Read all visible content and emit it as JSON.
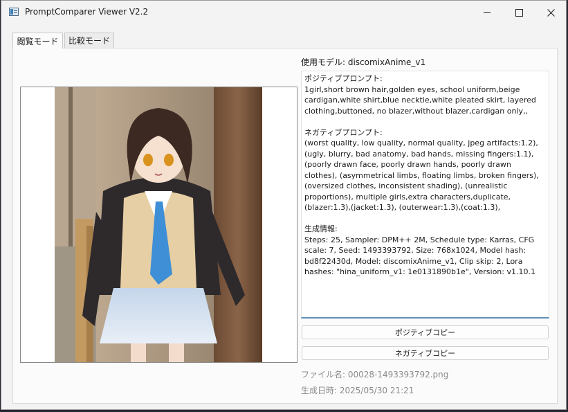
{
  "window": {
    "title": "PromptComparer Viewer V2.2"
  },
  "tabs": [
    {
      "label": "閲覧モード",
      "active": true
    },
    {
      "label": "比較モード",
      "active": false
    }
  ],
  "model": {
    "label": "使用モデル: discomixAnime_v1"
  },
  "prompt_text": "ポジティブプロンプト:\n1girl,short brown hair,golden eyes, school uniform,beige cardigan,white shirt,blue necktie,white pleated skirt, layered clothing,buttoned, no blazer,without blazer,cardigan only,,\n\nネガティブプロンプト:\n(worst quality, low quality, normal quality, jpeg artifacts:1.2), (ugly, blurry, bad anatomy, bad hands, missing fingers:1.1), (poorly drawn face, poorly drawn hands, poorly drawn clothes), (asymmetrical limbs, floating limbs, broken fingers), (oversized clothes, inconsistent shading), (unrealistic proportions), multiple girls,extra characters,duplicate,(blazer:1.3),(jacket:1.3), (outerwear:1.3),(coat:1.3),\n\n生成情報:\nSteps: 25, Sampler: DPM++ 2M, Schedule type: Karras, CFG scale: 7, Seed: 1493393792, Size: 768x1024, Model hash: bd8f22430d, Model: discomixAnime_v1, Clip skip: 2, Lora hashes: \"hina_uniform_v1: 1e0131890b1e\", Version: v1.10.1",
  "buttons": {
    "copy_positive": "ポジティブコピー",
    "copy_negative": "ネガティブコピー"
  },
  "info": {
    "file": "ファイル名: 00028-1493393792.png",
    "date": "生成日時: 2025/05/30 21:21"
  },
  "colors": {
    "accent": "#5e8fb8",
    "window_bg": "#f3f3f3",
    "panel_bg": "#fbfbfb"
  },
  "icons": {
    "app": "app-icon",
    "minimize": "minimize-icon",
    "maximize": "maximize-icon",
    "close": "close-icon"
  }
}
